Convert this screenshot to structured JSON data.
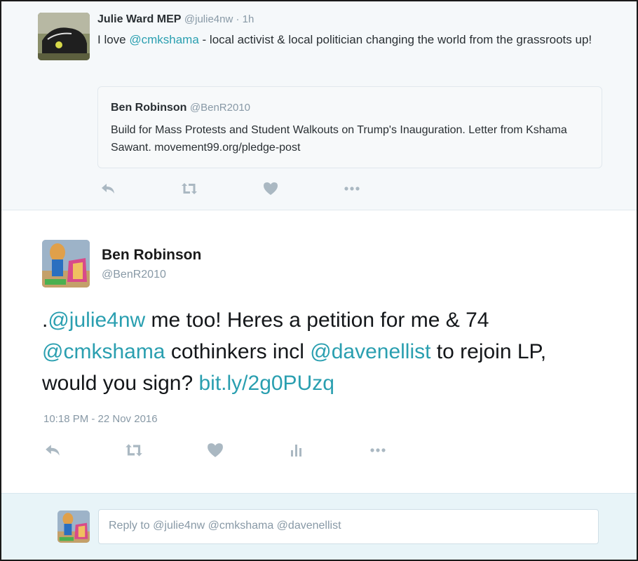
{
  "parent_tweet": {
    "name": "Julie Ward MEP",
    "handle": "@julie4nw",
    "time": " · 1h",
    "text_before": "I love ",
    "mention": "@cmkshama",
    "text_after": " - local activist & local politician changing the world from the grassroots up!",
    "quote": {
      "name": "Ben Robinson",
      "handle": "@BenR2010",
      "text": "Build for Mass Protests and Student Walkouts on Trump's Inauguration. Letter from Kshama Sawant.  movement99.org/pledge-post"
    },
    "actions": [
      "reply-icon",
      "retweet-icon",
      "like-icon",
      "more-icon"
    ]
  },
  "main_tweet": {
    "name": "Ben Robinson",
    "handle": "@BenR2010",
    "text": {
      "p0": ".",
      "m1": "@julie4nw",
      "p1": " me too! Heres a petition for me & 74 ",
      "m2": "@cmkshama",
      "p2": " cothinkers incl ",
      "m3": "@davenellist",
      "p3": " to rejoin LP, would you sign? ",
      "link": "bit.ly/2g0PUzq"
    },
    "timestamp": "10:18 PM - 22 Nov 2016",
    "actions": [
      "reply-icon",
      "retweet-icon",
      "like-icon",
      "analytics-icon",
      "more-icon"
    ]
  },
  "reply_box": {
    "placeholder": "Reply to @julie4nw @cmkshama @davenellist"
  },
  "colors": {
    "accent": "#2a9fb0",
    "meta": "#8899a6",
    "icon": "#aab8c2"
  }
}
